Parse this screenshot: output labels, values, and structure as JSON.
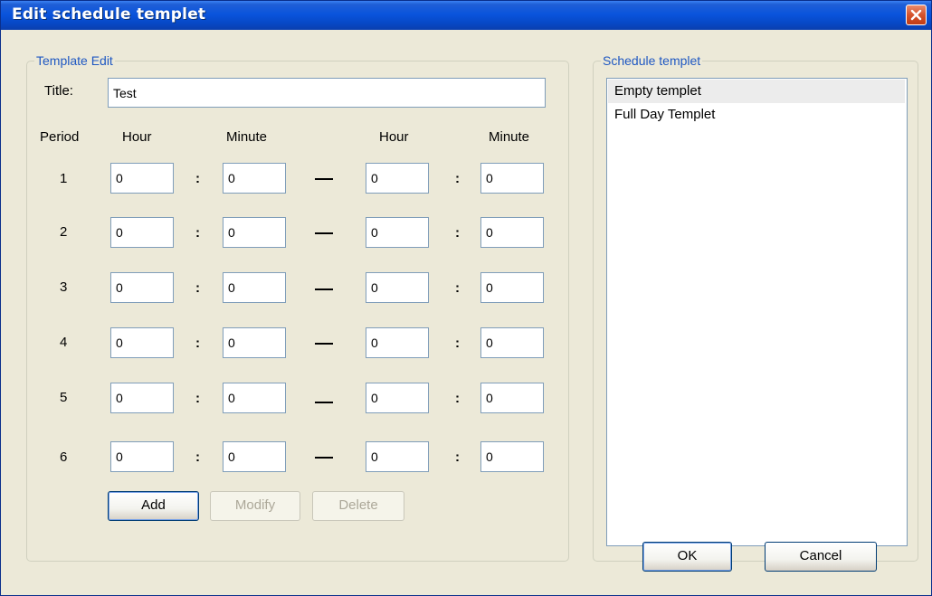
{
  "window": {
    "title": "Edit schedule templet"
  },
  "template_edit": {
    "legend": "Template Edit",
    "title_label": "Title:",
    "title_value": "Test",
    "headers": {
      "period": "Period",
      "start_hour": "Hour",
      "start_minute": "Minute",
      "end_hour": "Hour",
      "end_minute": "Minute"
    },
    "colon": ":",
    "periods": [
      {
        "num": "1",
        "start_hour": "0",
        "start_minute": "0",
        "end_hour": "0",
        "end_minute": "0"
      },
      {
        "num": "2",
        "start_hour": "0",
        "start_minute": "0",
        "end_hour": "0",
        "end_minute": "0"
      },
      {
        "num": "3",
        "start_hour": "0",
        "start_minute": "0",
        "end_hour": "0",
        "end_minute": "0"
      },
      {
        "num": "4",
        "start_hour": "0",
        "start_minute": "0",
        "end_hour": "0",
        "end_minute": "0"
      },
      {
        "num": "5",
        "start_hour": "0",
        "start_minute": "0",
        "end_hour": "0",
        "end_minute": "0"
      },
      {
        "num": "6",
        "start_hour": "0",
        "start_minute": "0",
        "end_hour": "0",
        "end_minute": "0"
      }
    ],
    "buttons": {
      "add": "Add",
      "modify": "Modify",
      "delete": "Delete"
    }
  },
  "schedule_templet": {
    "legend": "Schedule templet",
    "items": [
      "Empty templet",
      "Full Day Templet"
    ],
    "selected_index": 0
  },
  "dialog_buttons": {
    "ok": "OK",
    "cancel": "Cancel"
  },
  "colors": {
    "titlebar": "#0a54dc",
    "close_button": "#d5532c",
    "dialog_background": "#ece9d8",
    "legend_text": "#1f58c2",
    "field_border": "#7f9db9"
  },
  "icons": {
    "close": "close-icon"
  }
}
